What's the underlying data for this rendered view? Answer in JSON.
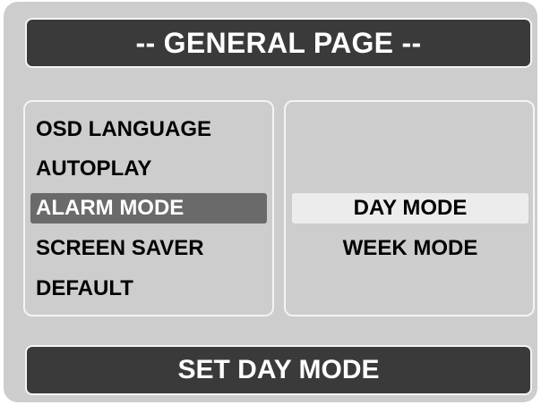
{
  "header": {
    "title": "-- GENERAL PAGE --"
  },
  "menu": {
    "items": [
      {
        "label": "OSD LANGUAGE",
        "selected": false
      },
      {
        "label": "AUTOPLAY",
        "selected": false
      },
      {
        "label": "ALARM MODE",
        "selected": true
      },
      {
        "label": "SCREEN SAVER",
        "selected": false
      },
      {
        "label": "DEFAULT",
        "selected": false
      }
    ]
  },
  "options": {
    "items": [
      {
        "label": "DAY MODE",
        "highlighted": true
      },
      {
        "label": "WEEK MODE",
        "highlighted": false
      }
    ]
  },
  "status": {
    "text": "SET DAY MODE"
  },
  "colors": {
    "background": "#cdcdcd",
    "bar": "#3a3a3a",
    "selected_item": "#6a6a6a",
    "highlighted_option": "#ececec",
    "border": "#f4f4f4"
  }
}
